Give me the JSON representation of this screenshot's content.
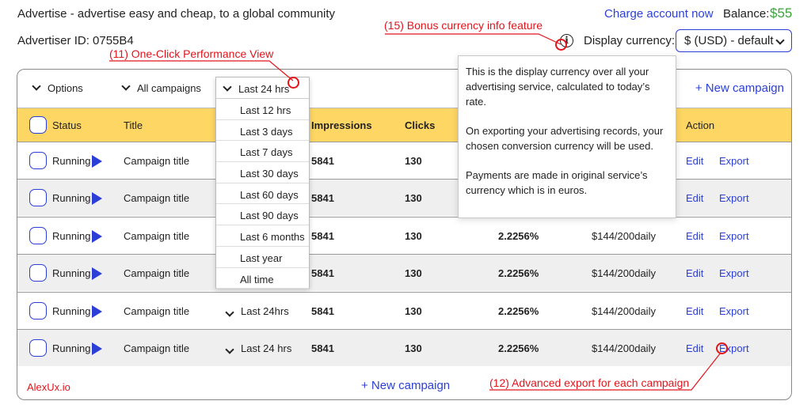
{
  "header": {
    "tagline": "Advertise - advertise easy and cheap, to a global community",
    "charge_link": "Charge account now",
    "balance_label": "Balance:",
    "balance_value": "$55",
    "advertiser_id": "Advertiser ID: 0755B4",
    "display_currency_label": "Display currency:",
    "currency_value": "$ (USD) - default",
    "info_icon_glyph": "i"
  },
  "annotations": {
    "bonus_currency": "(15) Bonus currency info feature",
    "one_click": "(11) One-Click Performance View",
    "advanced_export": "(12) Advanced export for each campaign"
  },
  "toolbar": {
    "options": "Options",
    "all_campaigns": "All campaigns",
    "new_campaign": "+ New campaign"
  },
  "table": {
    "headers": {
      "status": "Status",
      "title": "Title",
      "impressions": "Impressions",
      "clicks": "Clicks",
      "action": "Action"
    },
    "rows": [
      {
        "status": "Running",
        "title": "Campaign title",
        "period": "",
        "impressions": "5841",
        "clicks": "130",
        "ctr": "",
        "budget": "",
        "edit": "Edit",
        "export": "Export"
      },
      {
        "status": "Running",
        "title": "Campaign title",
        "period": "",
        "impressions": "5841",
        "clicks": "130",
        "ctr": "",
        "budget": "",
        "edit": "Edit",
        "export": "Export"
      },
      {
        "status": "Running",
        "title": "Campaign title",
        "period": "",
        "impressions": "5841",
        "clicks": "130",
        "ctr": "2.2256%",
        "budget": "$144/200daily",
        "edit": "Edit",
        "export": "Export"
      },
      {
        "status": "Running",
        "title": "Campaign title",
        "period": "",
        "impressions": "5841",
        "clicks": "130",
        "ctr": "2.2256%",
        "budget": "$144/200daily",
        "edit": "Edit",
        "export": "Export"
      },
      {
        "status": "Running",
        "title": "Campaign title",
        "period": "Last 24hrs",
        "impressions": "5841",
        "clicks": "130",
        "ctr": "2.2256%",
        "budget": "$144/200daily",
        "edit": "Edit",
        "export": "Export"
      },
      {
        "status": "Running",
        "title": "Campaign title",
        "period": "Last 24 hrs",
        "impressions": "5841",
        "clicks": "130",
        "ctr": "2.2256%",
        "budget": "$144/200daily",
        "edit": "Edit",
        "export": "Export"
      }
    ],
    "new_campaign_bottom": "+ New campaign"
  },
  "dropdown": {
    "selected": "Last 24 hrs",
    "options": [
      "Last 12 hrs",
      "Last 3 days",
      "Last 7 days",
      "Last 30 days",
      "Last 60 days",
      "Last 90 days",
      "Last 6 months",
      "Last year",
      "All time"
    ]
  },
  "tooltip": {
    "p1": "This is the display currency over all your advertising service, calculated to today’s rate.",
    "p2": "On exporting your advertising records, your chosen conversion currency will be used.",
    "p3": "Payments are made in original service’s currency which is in euros."
  },
  "brand": "AlexUx.io",
  "colors": {
    "accent_blue": "#2b3fd6",
    "header_yellow": "#fdd663",
    "annotation_red": "#e0151c",
    "balance_green": "#3aa33a"
  }
}
